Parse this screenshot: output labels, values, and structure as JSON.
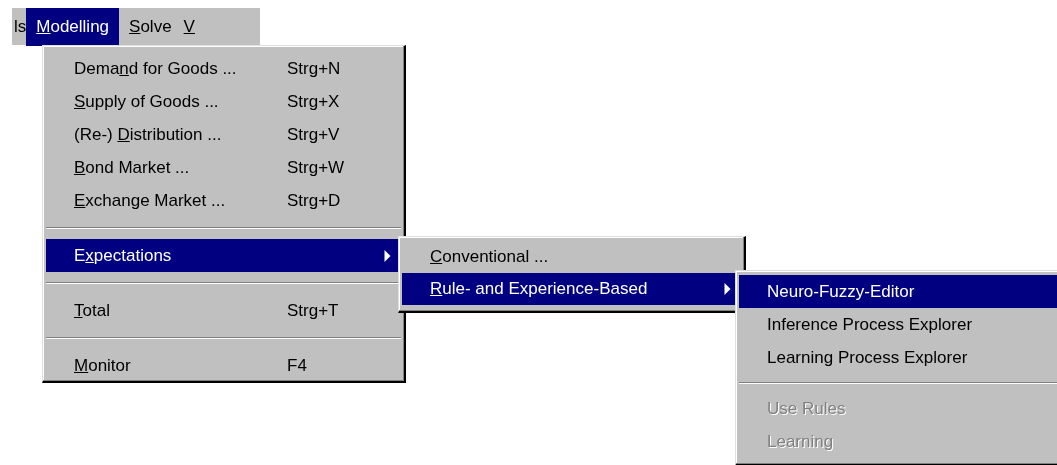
{
  "menu_bar": [
    {
      "label": [
        {
          "text": "ls",
          "underlined": false
        }
      ],
      "selected": false
    },
    {
      "label": [
        {
          "text": "M",
          "underlined": true
        },
        {
          "text": "odelling",
          "underlined": false
        }
      ],
      "selected": true
    },
    {
      "label": [
        {
          "text": "S",
          "underlined": true
        },
        {
          "text": "olve",
          "underlined": false
        }
      ],
      "selected": false
    },
    {
      "label": [
        {
          "text": "V",
          "underlined": true
        }
      ],
      "selected": false
    }
  ],
  "menus": [
    {
      "items": [
        {
          "kind": "item",
          "label": [
            {
              "text": "Dema",
              "underlined": false
            },
            {
              "text": "n",
              "underlined": true
            },
            {
              "text": "d for Goods ...",
              "underlined": false
            }
          ],
          "shortcut": "Strg+N",
          "selected": false,
          "disabled": false
        },
        {
          "kind": "item",
          "label": [
            {
              "text": "S",
              "underlined": true
            },
            {
              "text": "upply of Goods ...",
              "underlined": false
            }
          ],
          "shortcut": "Strg+X",
          "selected": false,
          "disabled": false
        },
        {
          "kind": "item",
          "label": [
            {
              "text": "(Re-) ",
              "underlined": false
            },
            {
              "text": "D",
              "underlined": true
            },
            {
              "text": "istribution ...",
              "underlined": false
            }
          ],
          "shortcut": "Strg+V",
          "selected": false,
          "disabled": false
        },
        {
          "kind": "item",
          "label": [
            {
              "text": "B",
              "underlined": true
            },
            {
              "text": "ond Market ...",
              "underlined": false
            }
          ],
          "shortcut": "Strg+W",
          "selected": false,
          "disabled": false
        },
        {
          "kind": "item",
          "label": [
            {
              "text": "E",
              "underlined": true
            },
            {
              "text": "xchange Market ...",
              "underlined": false
            }
          ],
          "shortcut": "Strg+D",
          "selected": false,
          "disabled": false
        },
        {
          "kind": "separator"
        },
        {
          "kind": "submenu",
          "label": [
            {
              "text": "E",
              "underlined": false
            },
            {
              "text": "x",
              "underlined": true
            },
            {
              "text": "pectations",
              "underlined": false
            }
          ],
          "selected": true,
          "disabled": false
        },
        {
          "kind": "separator"
        },
        {
          "kind": "item",
          "label": [
            {
              "text": "T",
              "underlined": true
            },
            {
              "text": "otal",
              "underlined": false
            }
          ],
          "shortcut": "Strg+T",
          "selected": false,
          "disabled": false
        },
        {
          "kind": "separator"
        },
        {
          "kind": "item",
          "label": [
            {
              "text": "M",
              "underlined": true
            },
            {
              "text": "onitor",
              "underlined": false
            }
          ],
          "shortcut": "F4",
          "selected": false,
          "disabled": false
        }
      ]
    },
    {
      "items": [
        {
          "kind": "item",
          "label": [
            {
              "text": "C",
              "underlined": true
            },
            {
              "text": "onventional ...",
              "underlined": false
            }
          ],
          "selected": false,
          "disabled": false
        },
        {
          "kind": "submenu",
          "label": [
            {
              "text": "R",
              "underlined": true
            },
            {
              "text": "ule- and Experience-Based",
              "underlined": false
            }
          ],
          "selected": true,
          "disabled": false
        }
      ]
    },
    {
      "items": [
        {
          "kind": "item",
          "label": [
            {
              "text": "Neuro-Fuzzy-Editor",
              "underlined": false
            }
          ],
          "selected": true,
          "disabled": false
        },
        {
          "kind": "item",
          "label": [
            {
              "text": "Inference Process Explorer",
              "underlined": false
            }
          ],
          "selected": false,
          "disabled": false
        },
        {
          "kind": "item",
          "label": [
            {
              "text": "Learning Process Explorer",
              "underlined": false
            }
          ],
          "selected": false,
          "disabled": false
        },
        {
          "kind": "separator"
        },
        {
          "kind": "item",
          "label": [
            {
              "text": "Use Rules",
              "underlined": false
            }
          ],
          "selected": false,
          "disabled": true
        },
        {
          "kind": "item",
          "label": [
            {
              "text": "Learning",
              "underlined": false
            }
          ],
          "selected": false,
          "disabled": true
        }
      ]
    }
  ]
}
